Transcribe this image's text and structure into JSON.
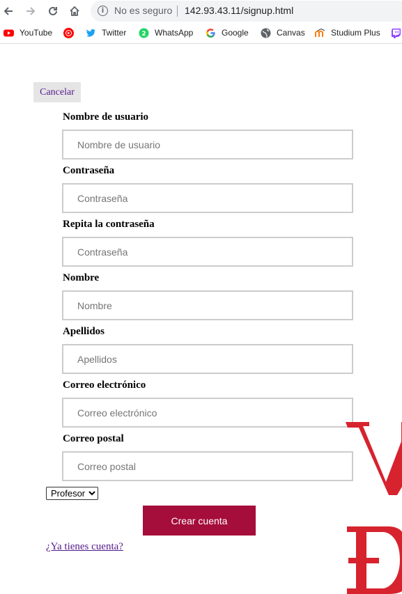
{
  "browser": {
    "security_text": "No es seguro",
    "url": "142.93.43.11/signup.html",
    "bookmarks": [
      {
        "label": "YouTube",
        "icon": "youtube-icon",
        "color": "#ff0000"
      },
      {
        "label": "",
        "icon": "youtube-music-icon",
        "color": "#ff0000"
      },
      {
        "label": "Twitter",
        "icon": "twitter-icon",
        "color": "#1da1f2"
      },
      {
        "label": "WhatsApp",
        "icon": "whatsapp-icon",
        "color": "#25d366"
      },
      {
        "label": "Google",
        "icon": "google-icon",
        "color": "#4285f4"
      },
      {
        "label": "Canvas",
        "icon": "globe-icon",
        "color": "#5f6368"
      },
      {
        "label": "Studium Plus",
        "icon": "moodle-icon",
        "color": "#f98012"
      },
      {
        "label": "",
        "icon": "twitch-icon",
        "color": "#9146ff"
      }
    ]
  },
  "page": {
    "cancel_label": "Cancelar",
    "fields": [
      {
        "label": "Nombre de usuario",
        "placeholder": "Nombre de usuario"
      },
      {
        "label": "Contraseña",
        "placeholder": "Contraseña"
      },
      {
        "label": "Repita la contraseña",
        "placeholder": "Contraseña"
      },
      {
        "label": "Nombre",
        "placeholder": "Nombre"
      },
      {
        "label": "Apellidos",
        "placeholder": "Apellidos"
      },
      {
        "label": "Correo electrónico",
        "placeholder": "Correo electrónico"
      },
      {
        "label": "Correo postal",
        "placeholder": "Correo postal"
      }
    ],
    "role_selected": "Profesor",
    "submit_label": "Crear cuenta",
    "login_link": "¿Ya tienes cuenta?",
    "logo_color": "#d6232e"
  }
}
